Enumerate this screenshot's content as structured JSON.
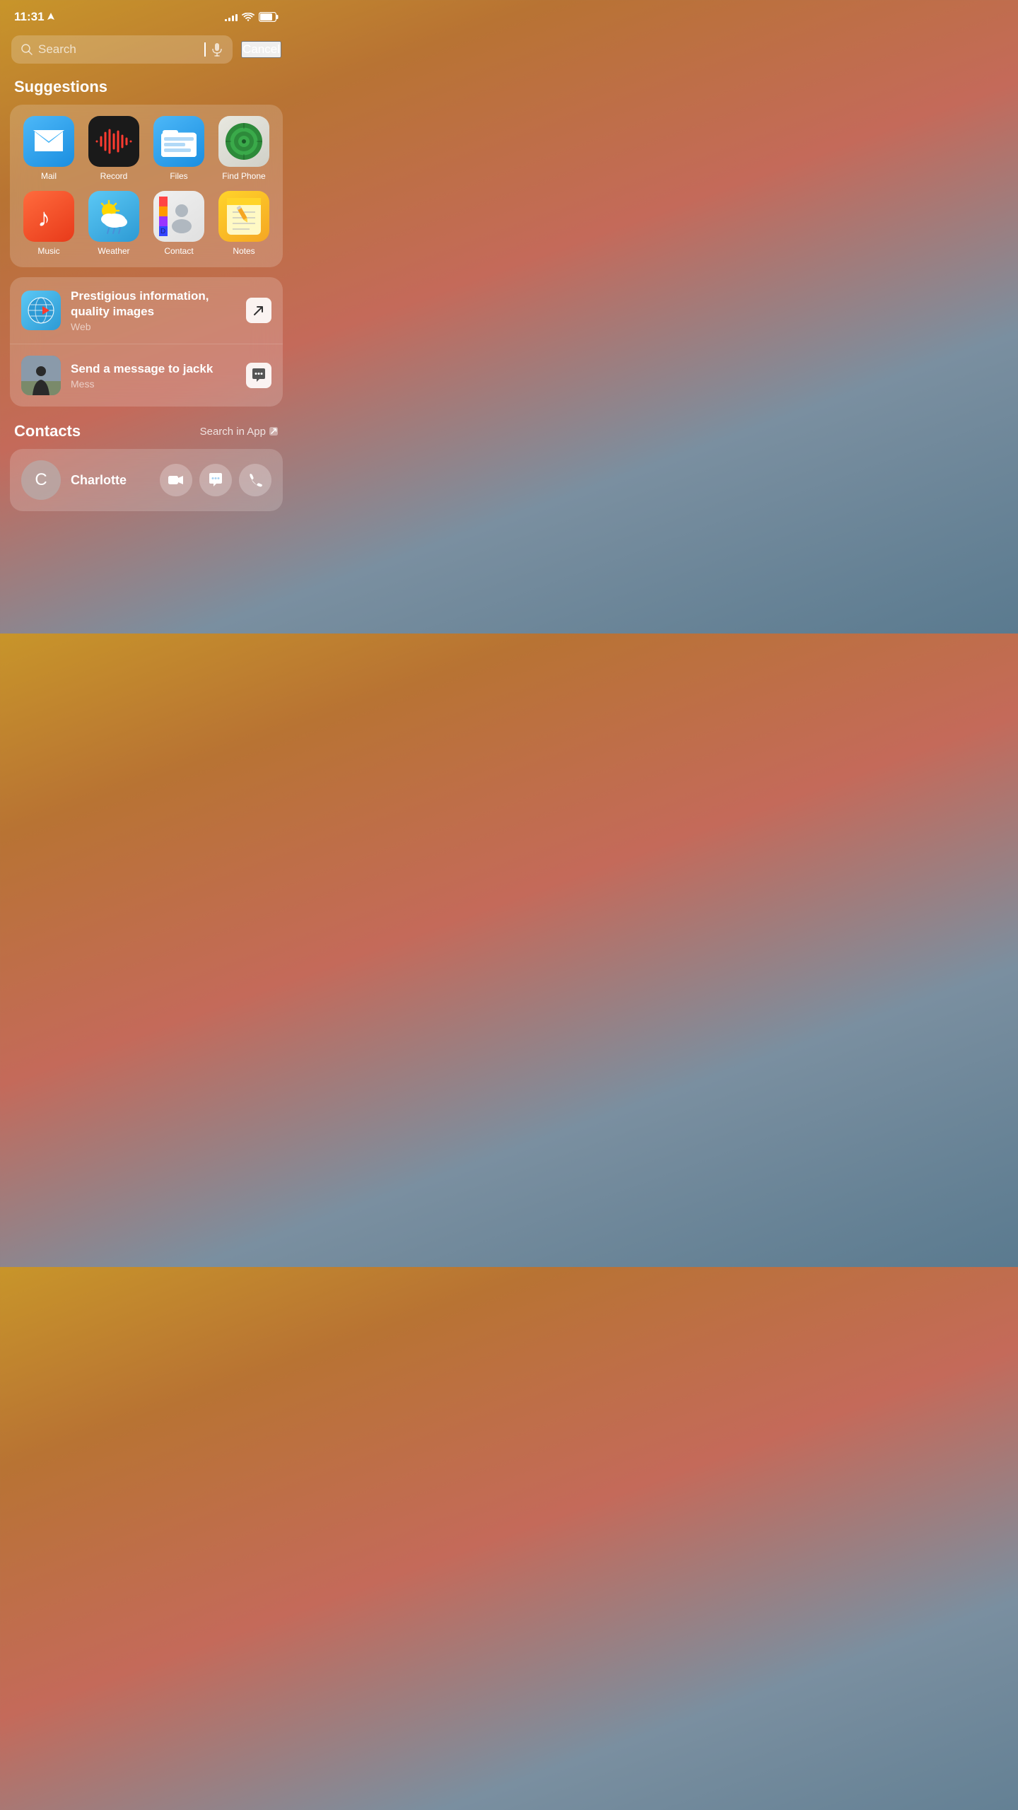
{
  "statusBar": {
    "time": "11:31",
    "locationIcon": "◀",
    "signalBars": [
      3,
      5,
      7,
      10,
      12
    ],
    "wifiLabel": "wifi",
    "batteryLabel": "battery"
  },
  "search": {
    "placeholder": "Search",
    "cancelLabel": "Cancel"
  },
  "suggestions": {
    "sectionTitle": "Suggestions",
    "apps": [
      {
        "name": "Mail",
        "icon": "mail"
      },
      {
        "name": "Record",
        "icon": "record"
      },
      {
        "name": "Files",
        "icon": "files"
      },
      {
        "name": "Find Phone",
        "icon": "findphone"
      },
      {
        "name": "Music",
        "icon": "music"
      },
      {
        "name": "Weather",
        "icon": "weather"
      },
      {
        "name": "Contact",
        "icon": "contact"
      },
      {
        "name": "Notes",
        "icon": "notes"
      }
    ],
    "items": [
      {
        "title": "Prestigious information, quality images",
        "subtitle": "Web",
        "actionType": "link"
      },
      {
        "title": "Send a message to jackk",
        "subtitle": "Mess",
        "actionType": "message"
      }
    ]
  },
  "contacts": {
    "sectionTitle": "Contacts",
    "searchInAppLabel": "Search in App",
    "contact": {
      "initial": "C",
      "name": "Charlotte",
      "actions": [
        "video",
        "message",
        "phone"
      ]
    }
  }
}
